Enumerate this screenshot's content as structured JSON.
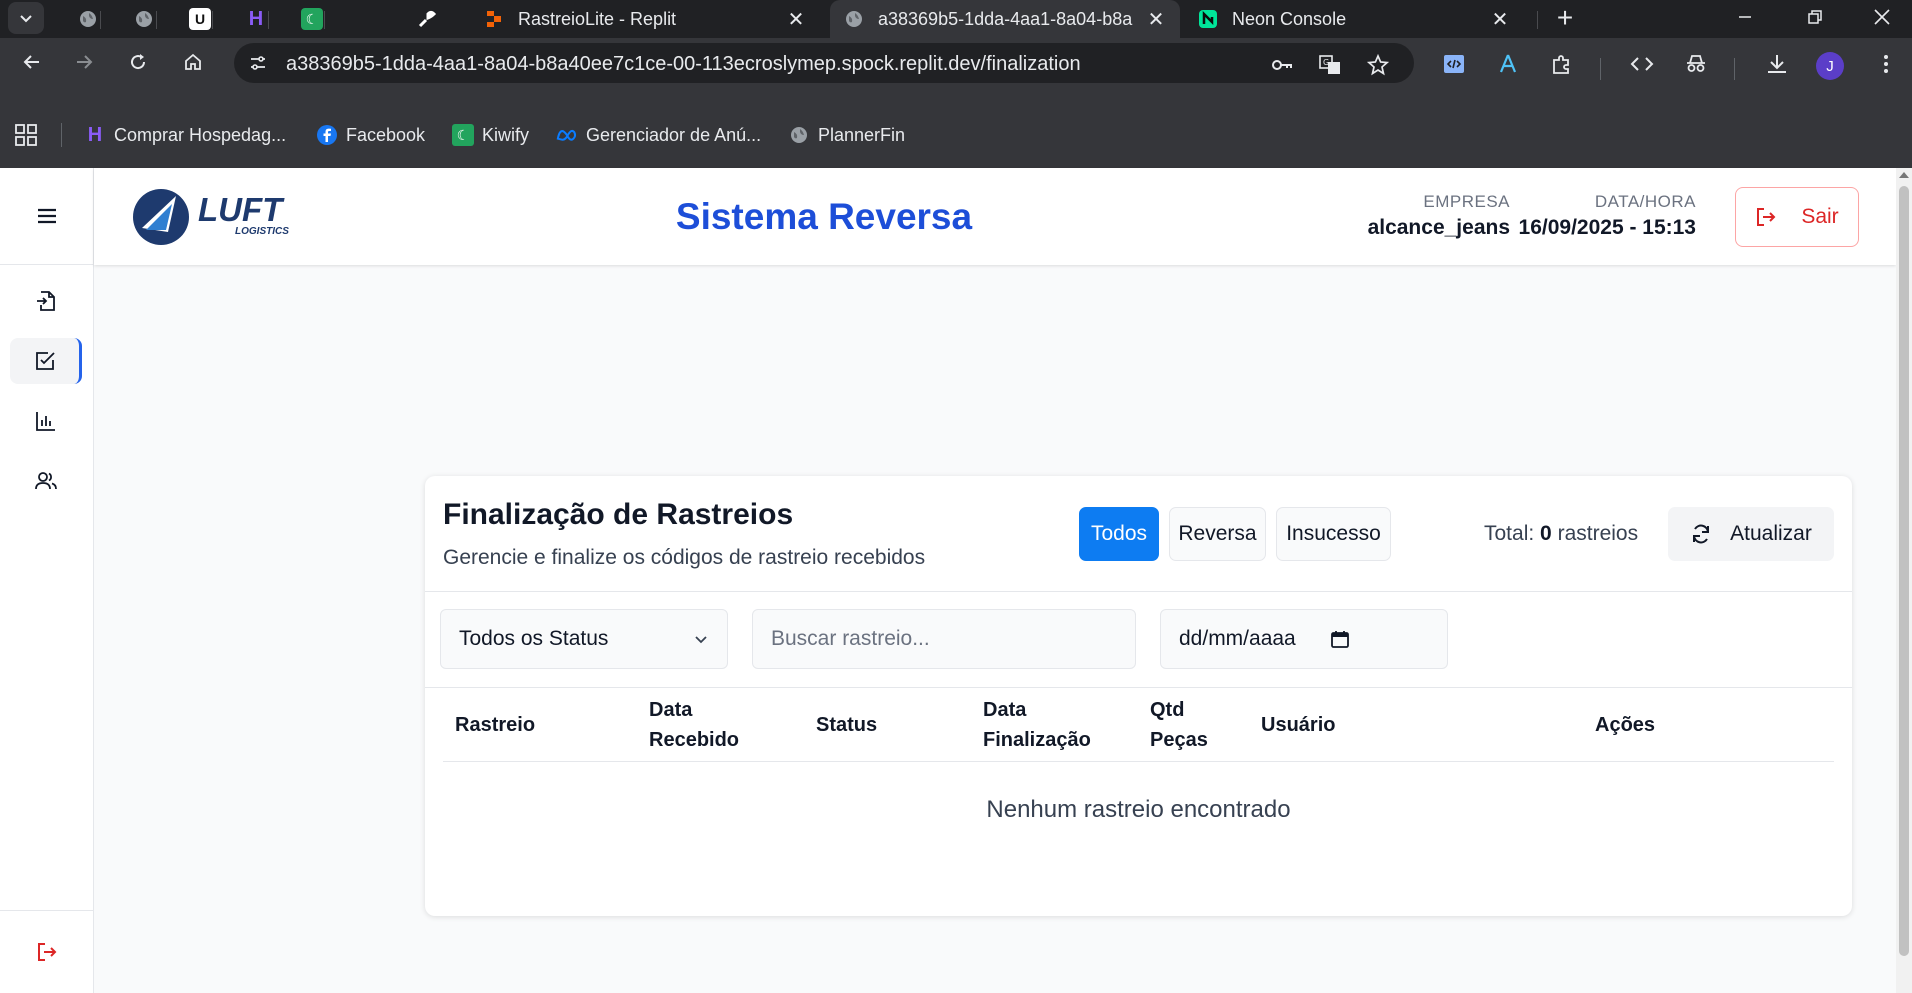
{
  "browser": {
    "tabs": [
      {
        "title": "RastreioLite - Replit",
        "close": "✕"
      },
      {
        "title": "a38369b5-1dda-4aa1-8a04-b8a",
        "close": "✕"
      },
      {
        "title": "Neon Console",
        "close": "✕"
      }
    ],
    "new_tab": "+",
    "url": "a38369b5-1dda-4aa1-8a04-b8a40ee7c1ce-00-113ecroslymep.spock.replit.dev/finalization",
    "profile_initial": "J",
    "bookmarks": [
      {
        "label": "Comprar Hospedag..."
      },
      {
        "label": "Facebook"
      },
      {
        "label": "Kiwify"
      },
      {
        "label": "Gerenciador de Anú..."
      },
      {
        "label": "PlannerFin"
      }
    ]
  },
  "header": {
    "logo_text": "LUFT",
    "logo_sub": "LOGISTICS",
    "title": "Sistema Reversa",
    "company_label": "EMPRESA",
    "company_value": "alcance_jeans",
    "datetime_label": "DATA/HORA",
    "datetime_value": "16/09/2025 - 15:13",
    "logout_label": "Sair"
  },
  "card": {
    "title": "Finalização de Rastreios",
    "subtitle": "Gerencie e finalize os códigos de rastreio recebidos",
    "filters": [
      {
        "label": "Todos",
        "active": true
      },
      {
        "label": "Reversa",
        "active": false
      },
      {
        "label": "Insucesso",
        "active": false
      }
    ],
    "total_prefix": "Total:",
    "total_count": "0",
    "total_suffix": "rastreios",
    "refresh_label": "Atualizar",
    "status_select": "Todos os Status",
    "search_placeholder": "Buscar rastreio...",
    "date_placeholder": "dd/mm/aaaa",
    "columns": [
      [
        "Rastreio"
      ],
      [
        "Data",
        "Recebido"
      ],
      [
        "Status"
      ],
      [
        "Data",
        "Finalização"
      ],
      [
        "Qtd",
        "Peças"
      ],
      [
        "Usuário"
      ],
      [
        "Ações"
      ]
    ],
    "empty_message": "Nenhum rastreio encontrado"
  },
  "colors": {
    "primary": "#0d7cf2",
    "title_blue": "#1d4ed8",
    "danger": "#dc2626",
    "browser_dark": "#202124",
    "browser_toolbar": "#35363a"
  }
}
